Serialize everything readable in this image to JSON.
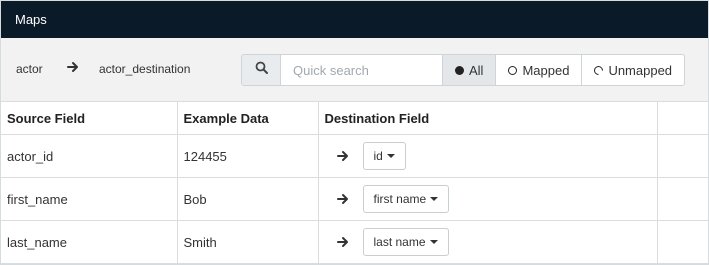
{
  "header": {
    "title": "Maps"
  },
  "toolbar": {
    "source": "actor",
    "target": "actor_destination",
    "search": {
      "placeholder": "Quick search",
      "value": ""
    },
    "filters": [
      {
        "label": "All",
        "icon": "filled-circle-icon",
        "active": true
      },
      {
        "label": "Mapped",
        "icon": "ring-circle-icon",
        "active": false
      },
      {
        "label": "Unmapped",
        "icon": "spinner-circle-icon",
        "active": false
      }
    ]
  },
  "table": {
    "columns": [
      "Source Field",
      "Example Data",
      "Destination Field",
      ""
    ],
    "rows": [
      {
        "source": "actor_id",
        "example": "124455",
        "destination": "id"
      },
      {
        "source": "first_name",
        "example": "Bob",
        "destination": "first name"
      },
      {
        "source": "last_name",
        "example": "Smith",
        "destination": "last name"
      }
    ]
  }
}
